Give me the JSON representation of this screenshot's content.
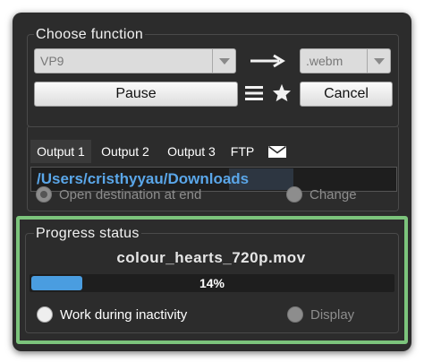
{
  "choose_function": {
    "title": "Choose function",
    "codec_select": "VP9",
    "container_select": ".webm",
    "pause_label": "Pause",
    "cancel_label": "Cancel"
  },
  "output": {
    "tabs": [
      "Output 1",
      "Output 2",
      "Output 3",
      "FTP"
    ],
    "active_tab": "Output 1",
    "path": "/Users/cristhyyau/Downloads",
    "open_destination_label": "Open destination at end",
    "change_label": "Change"
  },
  "progress": {
    "title": "Progress status",
    "filename": "colour_hearts_720p.mov",
    "percent": 14,
    "percent_text": "14%",
    "work_inactivity_label": "Work during inactivity",
    "display_label": "Display"
  },
  "colors": {
    "accent_blue": "#4a9de0",
    "highlight_green": "#7cc47c",
    "path_blue": "#5aa6e8"
  },
  "icons": {
    "arrow": "right-arrow-icon",
    "menu": "hamburger-menu-icon",
    "star": "star-icon",
    "mail": "envelope-icon"
  }
}
